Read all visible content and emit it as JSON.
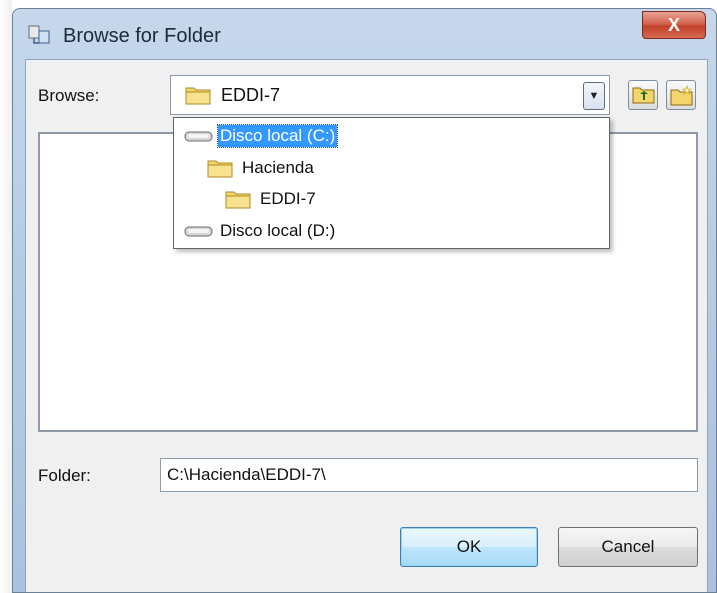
{
  "window": {
    "title": "Browse for Folder",
    "close_glyph": "X"
  },
  "browse": {
    "label": "Browse:",
    "selected_value": "EDDI-7",
    "options": [
      {
        "label": "Disco local (C:)",
        "icon": "drive-icon",
        "level": 0,
        "selected": true
      },
      {
        "label": "Hacienda",
        "icon": "folder-icon",
        "level": 1,
        "selected": false
      },
      {
        "label": "EDDI-7",
        "icon": "folder-icon",
        "level": 2,
        "selected": false
      },
      {
        "label": "Disco local (D:)",
        "icon": "drive-icon",
        "level": 0,
        "selected": false
      }
    ]
  },
  "toolbar": {
    "up_icon": "up-one-level-icon",
    "new_folder_icon": "new-folder-icon"
  },
  "folder": {
    "label": "Folder:",
    "value": "C:\\Hacienda\\EDDI-7\\"
  },
  "buttons": {
    "ok": "OK",
    "cancel": "Cancel"
  },
  "colors": {
    "selection": "#3399ff",
    "close_button": "#c2412a"
  }
}
